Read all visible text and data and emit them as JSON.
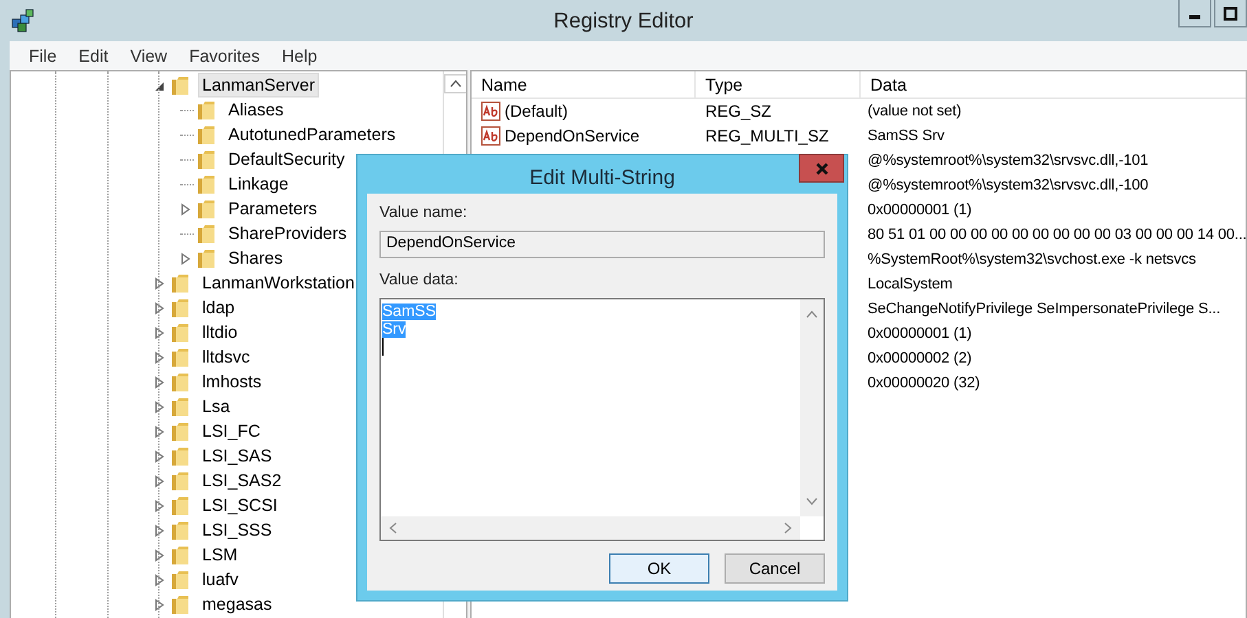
{
  "window": {
    "title": "Registry Editor"
  },
  "menu": [
    "File",
    "Edit",
    "View",
    "Favorites",
    "Help"
  ],
  "tree": {
    "items": [
      {
        "label": "LanmanServer",
        "selected": true,
        "expanded": true,
        "children": [
          {
            "label": "Aliases",
            "selected": false
          },
          {
            "label": "AutotunedParameters",
            "selected": false
          },
          {
            "label": "DefaultSecurity",
            "selected": false
          },
          {
            "label": "Linkage",
            "selected": false
          },
          {
            "label": "Parameters",
            "selected": false,
            "expanded": false
          },
          {
            "label": "ShareProviders",
            "selected": false
          },
          {
            "label": "Shares",
            "selected": false,
            "expanded": false
          }
        ]
      },
      {
        "label": "LanmanWorkstation",
        "selected": false,
        "expanded": false
      },
      {
        "label": "ldap",
        "selected": false,
        "expanded": false
      },
      {
        "label": "lltdio",
        "selected": false,
        "expanded": false
      },
      {
        "label": "lltdsvc",
        "selected": false,
        "expanded": false
      },
      {
        "label": "lmhosts",
        "selected": false,
        "expanded": false
      },
      {
        "label": "Lsa",
        "selected": false,
        "expanded": false
      },
      {
        "label": "LSI_FC",
        "selected": false,
        "expanded": false
      },
      {
        "label": "LSI_SAS",
        "selected": false,
        "expanded": false
      },
      {
        "label": "LSI_SAS2",
        "selected": false,
        "expanded": false
      },
      {
        "label": "LSI_SCSI",
        "selected": false,
        "expanded": false
      },
      {
        "label": "LSI_SSS",
        "selected": false,
        "expanded": false
      },
      {
        "label": "LSM",
        "selected": false,
        "expanded": false
      },
      {
        "label": "luafv",
        "selected": false,
        "expanded": false
      },
      {
        "label": "megasas",
        "selected": false,
        "expanded": false
      }
    ]
  },
  "values": {
    "columns": [
      "Name",
      "Type",
      "Data"
    ],
    "rows": [
      {
        "name": "(Default)",
        "type": "REG_SZ",
        "data": "(value not set)"
      },
      {
        "name": "DependOnService",
        "type": "REG_MULTI_SZ",
        "data": "SamSS Srv"
      },
      {
        "data": "@%systemroot%\\system32\\srvsvc.dll,-101"
      },
      {
        "data": "@%systemroot%\\system32\\srvsvc.dll,-100"
      },
      {
        "data": "0x00000001 (1)"
      },
      {
        "data": "80 51 01 00 00 00 00 00 00 00 00 00 03 00 00 00 14 00..."
      },
      {
        "data": "%SystemRoot%\\system32\\svchost.exe -k netsvcs"
      },
      {
        "data": "LocalSystem"
      },
      {
        "data": "SeChangeNotifyPrivilege SeImpersonatePrivilege S..."
      },
      {
        "data": "0x00000001 (1)"
      },
      {
        "data": "0x00000002 (2)"
      },
      {
        "data": "0x00000020 (32)"
      }
    ]
  },
  "dialog": {
    "title": "Edit Multi-String",
    "value_name_label": "Value name:",
    "value_name": "DependOnService",
    "value_data_label": "Value data:",
    "value_data": [
      {
        "text": "SamSS",
        "selected": true
      },
      {
        "text": "Srv",
        "selected": true
      }
    ],
    "buttons": [
      {
        "label": "OK",
        "default": true
      },
      {
        "label": "Cancel",
        "default": false
      }
    ]
  }
}
